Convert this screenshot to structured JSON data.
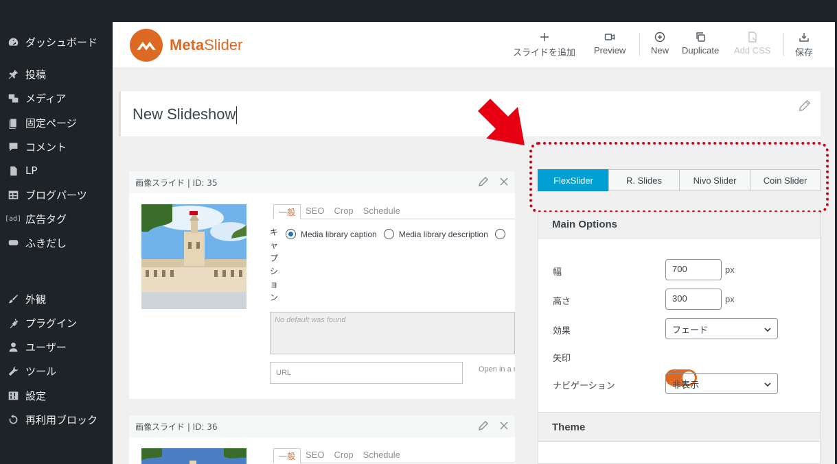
{
  "sidebar": {
    "items": [
      {
        "label": "ダッシュボード",
        "icon": "dashboard-icon"
      },
      {
        "label": "投稿",
        "icon": "pin-icon"
      },
      {
        "label": "メディア",
        "icon": "media-icon"
      },
      {
        "label": "固定ページ",
        "icon": "pages-icon"
      },
      {
        "label": "コメント",
        "icon": "comment-icon"
      },
      {
        "label": "LP",
        "icon": "document-icon"
      },
      {
        "label": "ブログパーツ",
        "icon": "grid-icon"
      },
      {
        "label": "広告タグ",
        "icon": "ad-icon",
        "glyph": "[ad]"
      },
      {
        "label": "ふきだし",
        "icon": "speech-bubble-icon"
      },
      {
        "label": "外観",
        "icon": "brush-icon"
      },
      {
        "label": "プラグイン",
        "icon": "plugin-icon"
      },
      {
        "label": "ユーザー",
        "icon": "user-icon"
      },
      {
        "label": "ツール",
        "icon": "wrench-icon"
      },
      {
        "label": "設定",
        "icon": "settings-icon"
      },
      {
        "label": "再利用ブロック",
        "icon": "reuse-icon"
      }
    ]
  },
  "header": {
    "logo_bold": "Meta",
    "logo_rest": "Slider",
    "toolbar": {
      "add_slide": "スライドを追加",
      "preview": "Preview",
      "new": "New",
      "duplicate": "Duplicate",
      "add_css": "Add CSS",
      "save": "保存"
    }
  },
  "slideshow": {
    "title": "New Slideshow"
  },
  "slides": [
    {
      "header": "画像スライド | ID: 35",
      "tabs": [
        "一般",
        "SEO",
        "Crop",
        "Schedule"
      ],
      "caption_label": "キャプション",
      "caption_options": [
        "Media library caption",
        "Media library description"
      ],
      "caption_placeholder": "No default was found",
      "url_placeholder": "URL",
      "new_tab_label": "Open in a new"
    },
    {
      "header": "画像スライド | ID: 36",
      "tabs": [
        "一般",
        "SEO",
        "Crop",
        "Schedule"
      ]
    }
  ],
  "slider_types": [
    "FlexSlider",
    "R. Slides",
    "Nivo Slider",
    "Coin Slider"
  ],
  "main_options": {
    "title": "Main Options",
    "width_label": "幅",
    "width_value": "700",
    "height_label": "高さ",
    "height_value": "300",
    "unit": "px",
    "effect_label": "効果",
    "effect_value": "フェード",
    "arrows_label": "矢印",
    "arrows_on": true,
    "nav_label": "ナビゲーション",
    "nav_value": "非表示"
  },
  "theme": {
    "title": "Theme"
  },
  "colors": {
    "accent": "#dd6923",
    "active_tab": "#00a0d2",
    "highlight": "#d0021b",
    "sidebar": "#1d2327"
  }
}
